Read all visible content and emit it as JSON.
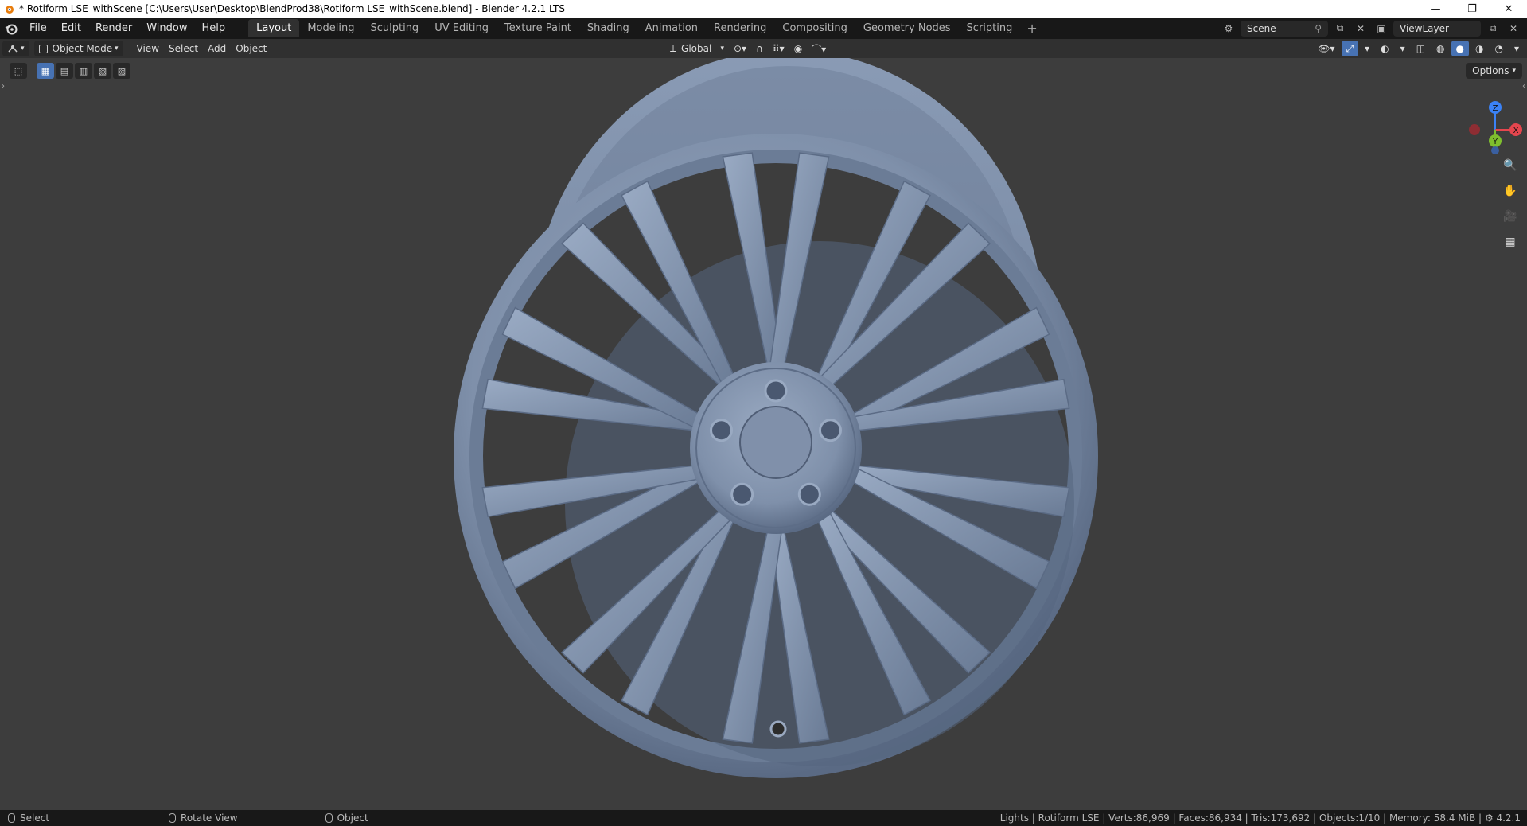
{
  "window": {
    "title": "* Rotiform LSE_withScene [C:\\Users\\User\\Desktop\\BlendProd38\\Rotiform LSE_withScene.blend] - Blender 4.2.1 LTS",
    "minimize": "—",
    "restore": "❐",
    "close": "✕"
  },
  "menu": [
    "File",
    "Edit",
    "Render",
    "Window",
    "Help"
  ],
  "workspaces": [
    "Layout",
    "Modeling",
    "Sculpting",
    "UV Editing",
    "Texture Paint",
    "Shading",
    "Animation",
    "Rendering",
    "Compositing",
    "Geometry Nodes",
    "Scripting"
  ],
  "workspace_add": "+",
  "scene": "Scene",
  "view_layer": "ViewLayer",
  "header": {
    "mode": "Object Mode",
    "menus": [
      "View",
      "Select",
      "Add",
      "Object"
    ],
    "transform_orientation": "Global"
  },
  "viewport": {
    "options_label": "Options",
    "gizmo": {
      "z": "Z",
      "x": "X",
      "y": "Y"
    }
  },
  "status": {
    "left": [
      {
        "label": "Select"
      },
      {
        "label": "Rotate View"
      },
      {
        "label": "Object"
      }
    ],
    "stats": "Lights | Rotiform LSE | Verts:86,969 | Faces:86,934 | Tris:173,692 | Objects:1/10 | Memory: 58.4 MiB | ",
    "version": "4.2.1"
  },
  "colors": {
    "topbar": "#181818",
    "header": "#303030",
    "viewport": "#3d3d3d",
    "accent": "#4772b3",
    "wheel": "#7d8ea8"
  }
}
